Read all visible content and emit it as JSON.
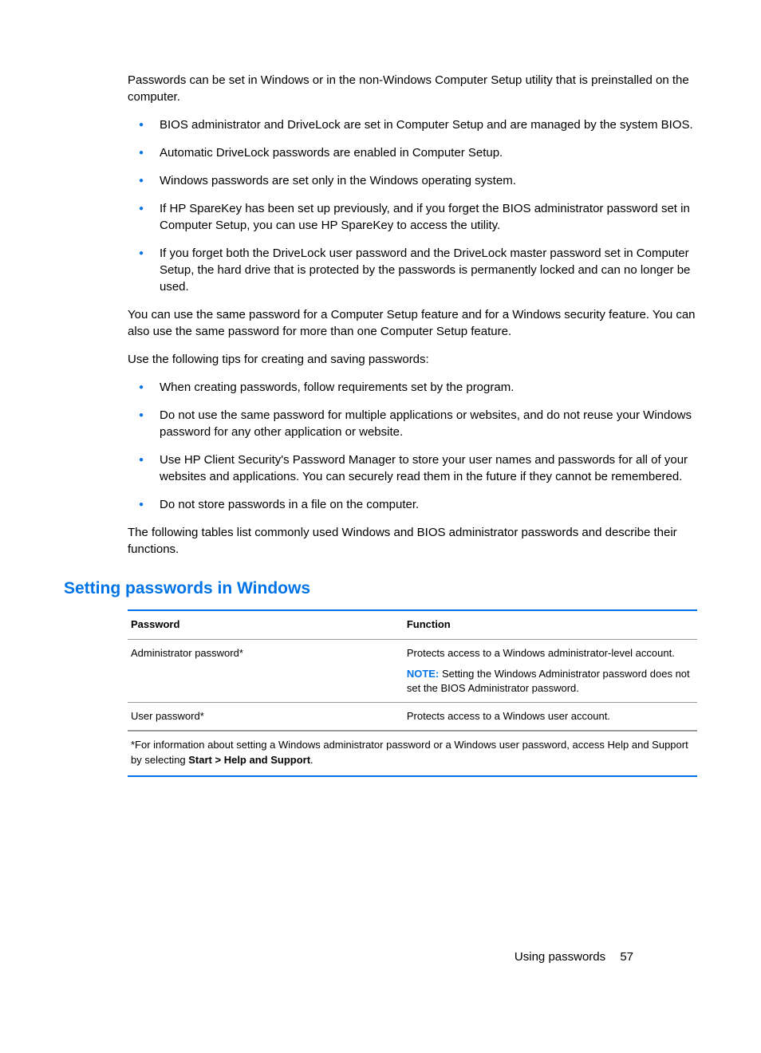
{
  "intro": "Passwords can be set in Windows or in the non-Windows Computer Setup utility that is preinstalled on the computer.",
  "bullets1": [
    "BIOS administrator and DriveLock are set in Computer Setup and are managed by the system BIOS.",
    "Automatic DriveLock passwords are enabled in Computer Setup.",
    "Windows passwords are set only in the Windows operating system.",
    "If HP SpareKey has been set up previously, and if you forget the BIOS administrator password set in Computer Setup, you can use HP SpareKey to access the utility.",
    "If you forget both the DriveLock user password and the DriveLock master password set in Computer Setup, the hard drive that is protected by the passwords is permanently locked and can no longer be used."
  ],
  "para2": "You can use the same password for a Computer Setup feature and for a Windows security feature. You can also use the same password for more than one Computer Setup feature.",
  "para3": "Use the following tips for creating and saving passwords:",
  "bullets2": [
    "When creating passwords, follow requirements set by the program.",
    "Do not use the same password for multiple applications or websites, and do not reuse your Windows password for any other application or website.",
    "Use HP Client Security's Password Manager to store your user names and passwords for all of your websites and applications. You can securely read them in the future if they cannot be remembered.",
    "Do not store passwords in a file on the computer."
  ],
  "para4": "The following tables list commonly used Windows and BIOS administrator passwords and describe their functions.",
  "section_heading": "Setting passwords in Windows",
  "table": {
    "h1": "Password",
    "h2": "Function",
    "r1c1": "Administrator password*",
    "r1c2": "Protects access to a Windows administrator-level account.",
    "note_label": "NOTE:",
    "note_text": "Setting the Windows Administrator password does not set the BIOS Administrator password.",
    "r2c1": "User password*",
    "r2c2": "Protects access to a Windows user account.",
    "footnote_pre": "*For information about setting a Windows administrator password or a Windows user password, access Help and Support by selecting ",
    "footnote_bold": "Start > Help and Support",
    "footnote_post": "."
  },
  "footer": {
    "label": "Using passwords",
    "page": "57"
  }
}
